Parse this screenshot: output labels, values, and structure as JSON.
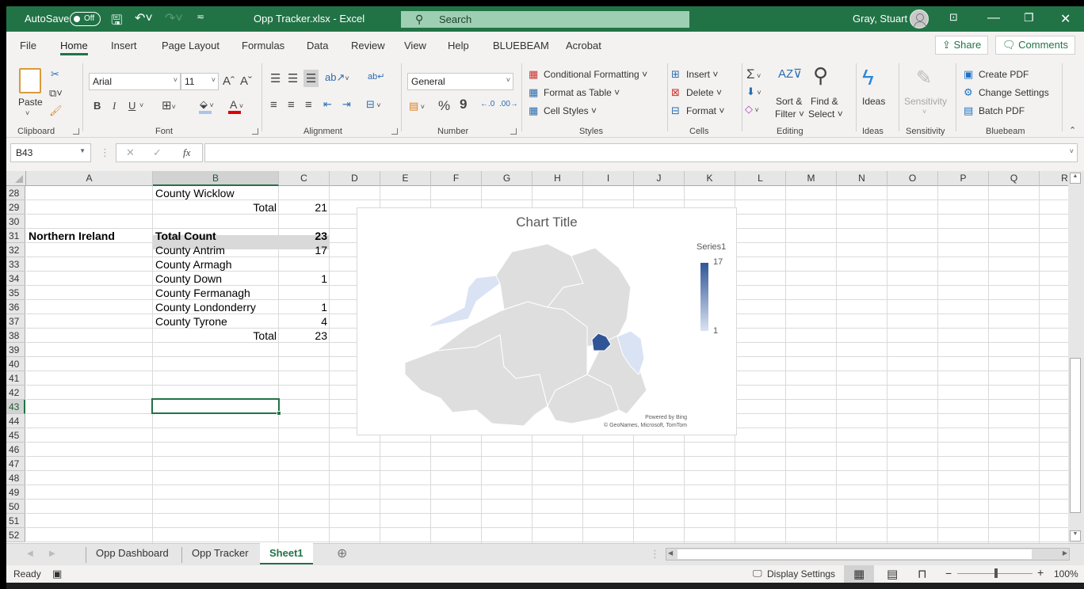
{
  "titlebar": {
    "autosave_label": "AutoSave",
    "autosave_state": "Off",
    "file_title": "Opp Tracker.xlsx  -  Excel",
    "search_placeholder": "Search",
    "user_name": "Gray, Stuart"
  },
  "menu": {
    "tabs": [
      "File",
      "Home",
      "Insert",
      "Page Layout",
      "Formulas",
      "Data",
      "Review",
      "View",
      "Help",
      "BLUEBEAM",
      "Acrobat"
    ],
    "active": "Home",
    "share_label": "Share",
    "comments_label": "Comments"
  },
  "ribbon": {
    "clipboard": {
      "paste": "Paste",
      "label": "Clipboard"
    },
    "font": {
      "name": "Arial",
      "size": "11",
      "bold": "B",
      "italic": "I",
      "underline": "U",
      "label": "Font",
      "fill_color": "#a9c4eb",
      "font_color": "#e00000"
    },
    "alignment": {
      "label": "Alignment"
    },
    "number": {
      "format": "General",
      "percent": "%",
      "comma": "9",
      "label": "Number"
    },
    "styles": {
      "conditional": "Conditional Formatting",
      "format_table": "Format as Table",
      "cell_styles": "Cell Styles",
      "label": "Styles"
    },
    "cells": {
      "insert": "Insert",
      "delete": "Delete",
      "format": "Format",
      "label": "Cells"
    },
    "editing": {
      "sort1": "Sort &",
      "sort2": "Filter",
      "find1": "Find &",
      "find2": "Select",
      "label": "Editing"
    },
    "ideas": {
      "button": "Ideas",
      "label": "Ideas"
    },
    "sensitivity": {
      "button": "Sensitivity",
      "label": "Sensitivity"
    },
    "bluebeam": {
      "create": "Create PDF",
      "change": "Change Settings",
      "batch": "Batch PDF",
      "label": "Bluebeam"
    }
  },
  "formula_bar": {
    "name_box": "B43",
    "formula": "",
    "fx": "fx"
  },
  "columns": [
    "A",
    "B",
    "C",
    "D",
    "E",
    "F",
    "G",
    "H",
    "I",
    "J",
    "K",
    "L",
    "M",
    "N",
    "O",
    "P",
    "Q",
    "R"
  ],
  "selected_column": "B",
  "rows": [
    "28",
    "29",
    "30",
    "31",
    "32",
    "33",
    "34",
    "35",
    "36",
    "37",
    "38",
    "39",
    "40",
    "41",
    "42",
    "43",
    "44",
    "45",
    "46",
    "47",
    "48",
    "49",
    "50",
    "51",
    "52"
  ],
  "selected_row": "43",
  "cells": {
    "r28": {
      "B": "County Wicklow",
      "C": ""
    },
    "r29": {
      "B": "Total",
      "C": "21"
    },
    "r31": {
      "A": "Northern Ireland",
      "B": "Total Count",
      "C": "23"
    },
    "r32": {
      "B": "County Antrim",
      "C": "17"
    },
    "r33": {
      "B": "County Armagh",
      "C": ""
    },
    "r34": {
      "B": "County Down",
      "C": "1"
    },
    "r35": {
      "B": "County Fermanagh",
      "C": ""
    },
    "r36": {
      "B": "County Londonderry",
      "C": "1"
    },
    "r37": {
      "B": "County Tyrone",
      "C": "4"
    },
    "r38": {
      "B": "Total",
      "C": "23"
    }
  },
  "chart_data": {
    "type": "map",
    "title": "Chart Title",
    "legend_title": "Series1",
    "legend_max": 17,
    "legend_min": 1,
    "color_max": "#2f5597",
    "color_min": "#dae3f3",
    "no_data_color": "#dedede",
    "regions": [
      {
        "name": "County Antrim",
        "value": 17
      },
      {
        "name": "County Armagh",
        "value": null
      },
      {
        "name": "County Down",
        "value": 1
      },
      {
        "name": "County Fermanagh",
        "value": null
      },
      {
        "name": "County Londonderry",
        "value": 1
      },
      {
        "name": "County Tyrone",
        "value": 4
      }
    ],
    "attribution_1": "Powered by Bing",
    "attribution_2": "© GeoNames, Microsoft, TomTom"
  },
  "sheet_tabs": [
    "Opp Dashboard",
    "Opp Tracker",
    "Sheet1"
  ],
  "active_sheet": "Sheet1",
  "status": {
    "ready": "Ready",
    "display_settings": "Display Settings",
    "zoom": "100%",
    "zoom_level": 1.0
  }
}
